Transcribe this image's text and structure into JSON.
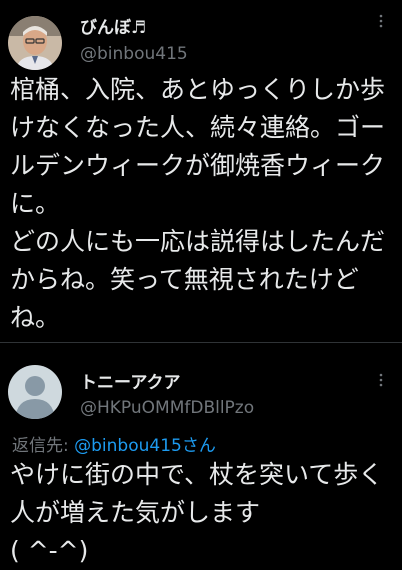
{
  "main_tweet": {
    "display_name": "びんぼ♬",
    "handle": "@binbou415",
    "more_icon": "more-options-icon",
    "text": "棺桶、入院、あとゆっくりしか歩けなくなった人、続々連絡。ゴールデンウィークが御焼香ウィークに。\nどの人にも一応は説得はしたんだからね。笑って無視されたけどね。"
  },
  "reply_tweet": {
    "display_name": "トニーアクア",
    "handle": "@HKPuOMMfDBllPzo",
    "more_icon": "more-options-icon",
    "reply_prefix": "返信先: ",
    "reply_mention": "@binbou415さん",
    "text": "やけに街の中で、杖を突いて歩く人が増えた気がします\n( ^-^)"
  },
  "colors": {
    "background": "#000000",
    "text": "#e7e9ea",
    "secondary": "#71767b",
    "link": "#1d9bf0",
    "divider": "#2f3336"
  }
}
